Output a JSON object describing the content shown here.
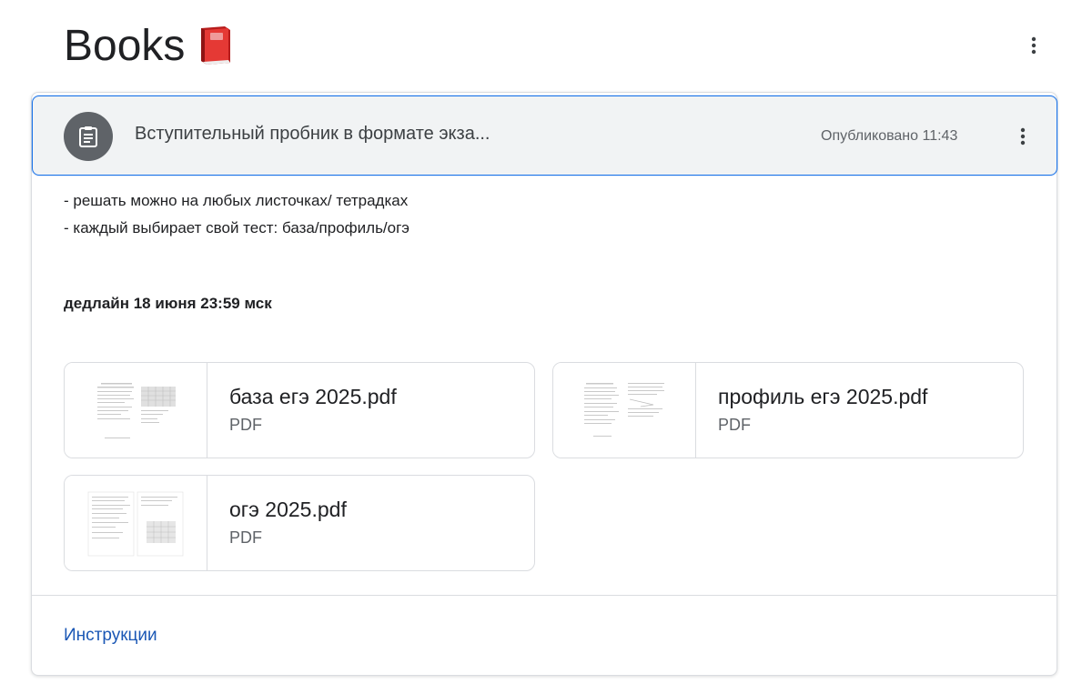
{
  "page": {
    "title": "Books"
  },
  "assignment": {
    "title": "Вступительный пробник в формате экза...",
    "published": "Опубликовано 11:43",
    "description_lines": [
      "- решать можно на любых листочках/ тетрадках",
      "- каждый выбирает свой тест: база/профиль/огэ"
    ],
    "deadline": "дедлайн 18 июня 23:59 мск",
    "attachments": [
      {
        "name": "база егэ 2025.pdf",
        "type": "PDF"
      },
      {
        "name": "профиль егэ 2025.pdf",
        "type": "PDF"
      },
      {
        "name": "огэ 2025.pdf",
        "type": "PDF"
      }
    ],
    "instructions_label": "Инструкции"
  },
  "icons": {
    "title_emoji": "closed-book-icon",
    "assignment_icon": "assignment-clipboard-icon",
    "menu_icon": "more-vertical-icon"
  },
  "colors": {
    "accent_blue": "#1a73e8",
    "link_blue": "#1a57b5",
    "avatar_gray": "#5f6368",
    "header_bg": "#f1f3f4",
    "book_red": "#d32f2f"
  }
}
